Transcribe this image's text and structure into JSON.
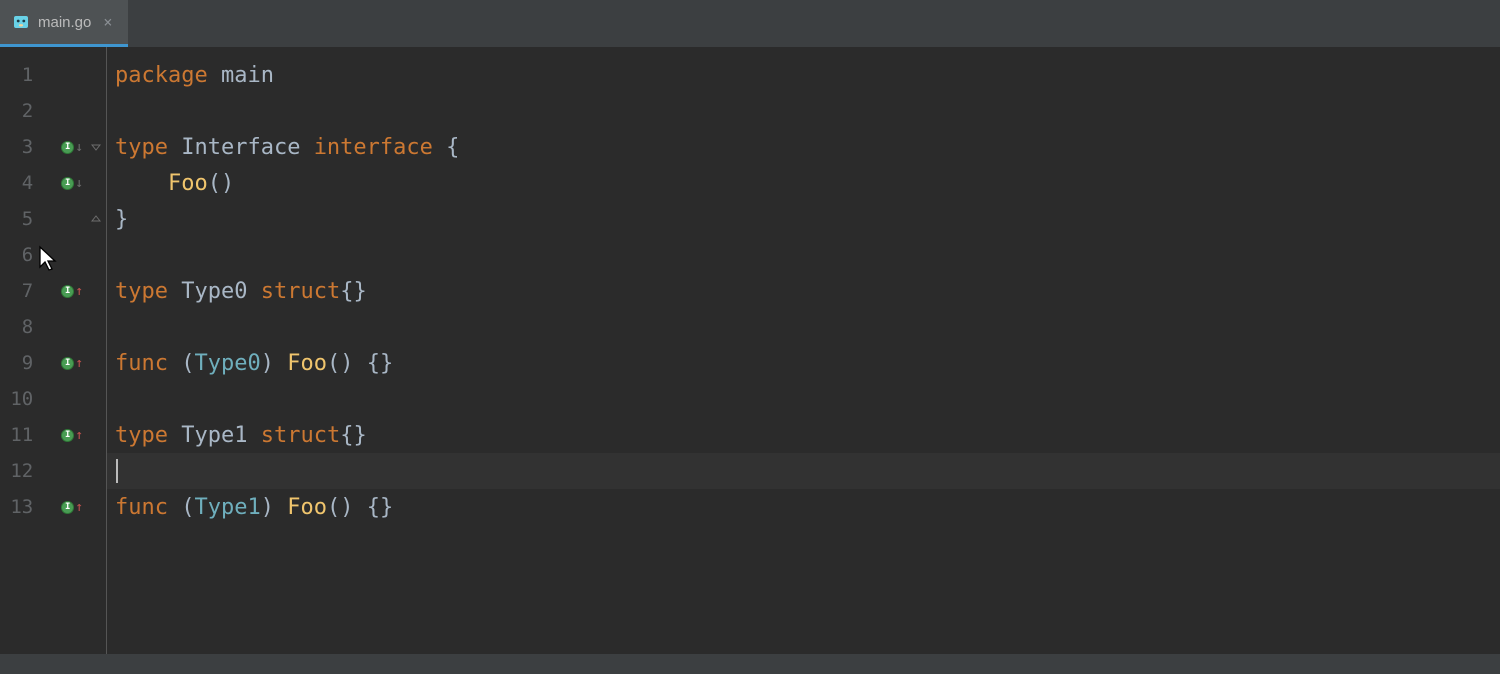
{
  "tab": {
    "filename": "main.go",
    "close_label": "×"
  },
  "lines": [
    {
      "num": "1",
      "marker": null,
      "fold": null,
      "tokens": [
        {
          "c": "kw",
          "t": "package "
        },
        {
          "c": "ident",
          "t": "main"
        }
      ]
    },
    {
      "num": "2",
      "marker": null,
      "fold": null,
      "tokens": []
    },
    {
      "num": "3",
      "marker": "impl-down",
      "fold": "start",
      "tokens": [
        {
          "c": "kw",
          "t": "type "
        },
        {
          "c": "ident",
          "t": "Interface "
        },
        {
          "c": "kw",
          "t": "interface"
        },
        {
          "c": "punct",
          "t": " {"
        }
      ]
    },
    {
      "num": "4",
      "marker": "impl-down",
      "fold": null,
      "tokens": [
        {
          "c": "punct",
          "t": "    "
        },
        {
          "c": "methodname",
          "t": "Foo"
        },
        {
          "c": "punct",
          "t": "()"
        }
      ]
    },
    {
      "num": "5",
      "marker": null,
      "fold": "end",
      "tokens": [
        {
          "c": "punct",
          "t": "}"
        }
      ]
    },
    {
      "num": "6",
      "marker": null,
      "fold": null,
      "tokens": []
    },
    {
      "num": "7",
      "marker": "impl-up",
      "fold": null,
      "tokens": [
        {
          "c": "kw",
          "t": "type "
        },
        {
          "c": "ident",
          "t": "Type0 "
        },
        {
          "c": "kw",
          "t": "struct"
        },
        {
          "c": "punct",
          "t": "{}"
        }
      ]
    },
    {
      "num": "8",
      "marker": null,
      "fold": null,
      "tokens": []
    },
    {
      "num": "9",
      "marker": "impl-up",
      "fold": null,
      "tokens": [
        {
          "c": "kw",
          "t": "func "
        },
        {
          "c": "punct",
          "t": "("
        },
        {
          "c": "typename",
          "t": "Type0"
        },
        {
          "c": "punct",
          "t": ") "
        },
        {
          "c": "methodname",
          "t": "Foo"
        },
        {
          "c": "punct",
          "t": "() {}"
        }
      ]
    },
    {
      "num": "10",
      "marker": null,
      "fold": null,
      "tokens": []
    },
    {
      "num": "11",
      "marker": "impl-up",
      "fold": null,
      "tokens": [
        {
          "c": "kw",
          "t": "type "
        },
        {
          "c": "ident",
          "t": "Type1 "
        },
        {
          "c": "kw",
          "t": "struct"
        },
        {
          "c": "punct",
          "t": "{}"
        }
      ]
    },
    {
      "num": "12",
      "marker": null,
      "fold": null,
      "tokens": [],
      "caret": true,
      "current": true
    },
    {
      "num": "13",
      "marker": "impl-up",
      "fold": null,
      "tokens": [
        {
          "c": "kw",
          "t": "func "
        },
        {
          "c": "punct",
          "t": "("
        },
        {
          "c": "typename",
          "t": "Type1"
        },
        {
          "c": "punct",
          "t": ") "
        },
        {
          "c": "methodname",
          "t": "Foo"
        },
        {
          "c": "punct",
          "t": "() {}"
        }
      ]
    }
  ]
}
